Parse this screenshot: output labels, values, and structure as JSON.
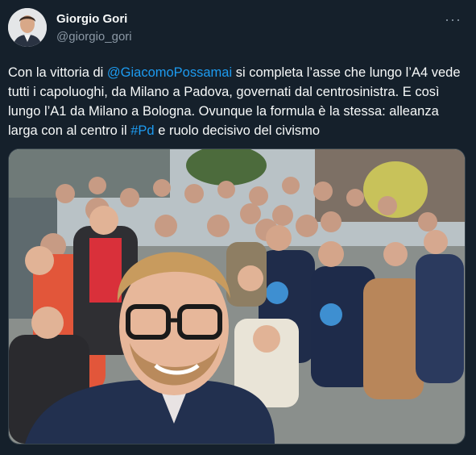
{
  "author": {
    "display_name": "Giorgio Gori",
    "handle": "@giorgio_gori"
  },
  "menu_icon": "more-dots-icon",
  "more_glyph": "···",
  "tweet": {
    "t1": "Con la vittoria di ",
    "mention": "@GiacomoPossamai",
    "t2": " si completa l’asse che lungo l’A4 vede tutti i capoluoghi, da Milano a Padova, governati dal centrosinistra. E così lungo l’A1 da Milano a Bologna. Ovunque la formula è la stessa: alleanza larga con al centro il ",
    "hashtag": "#Pd",
    "t3": " e ruolo decisivo del civismo"
  },
  "colors": {
    "background": "#15202b",
    "text": "#f7f9f9",
    "secondary": "#8b98a5",
    "link": "#1d9bf0"
  }
}
